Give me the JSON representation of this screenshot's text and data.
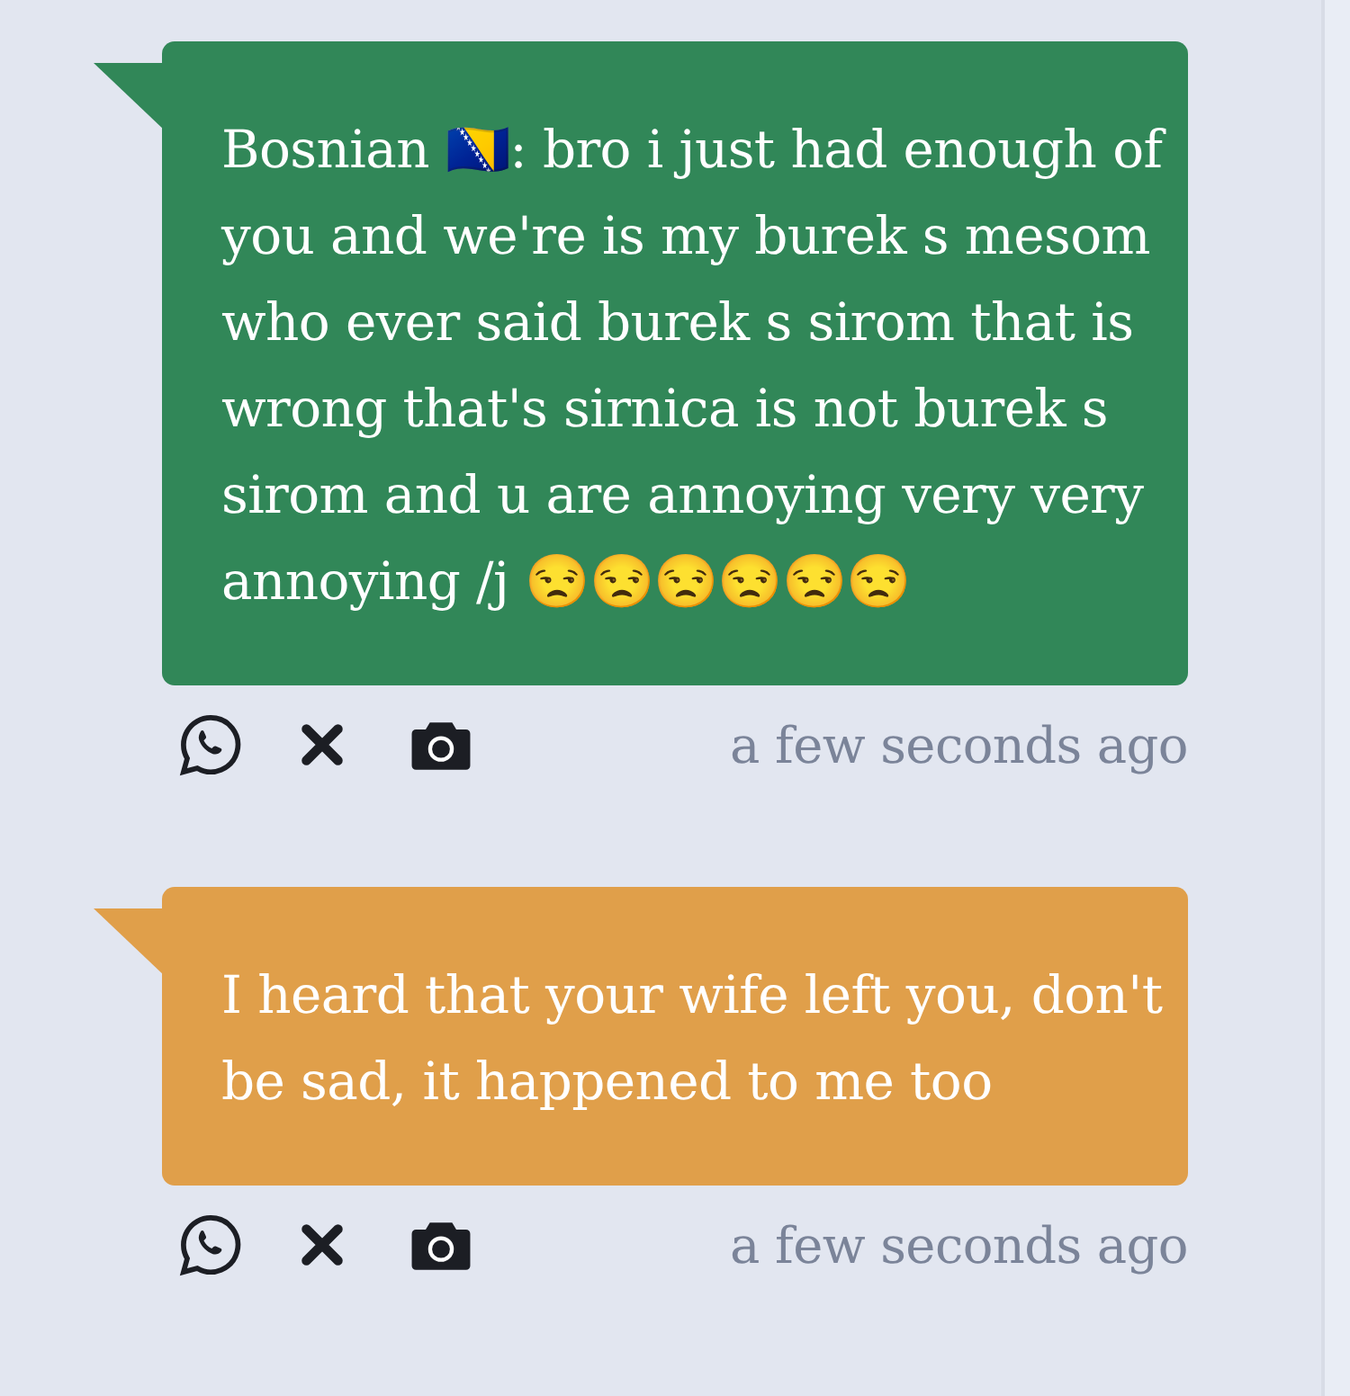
{
  "messages": [
    {
      "text": "Bosnian 🇧🇦: bro i just had enough of you and we're is my burek s mesom who ever said burek s sirom that is wrong that's sirnica is not burek s sirom and u are annoying very very annoying /j 😒😒😒😒😒😒",
      "color": "#318758",
      "time": "a few seconds ago"
    },
    {
      "text": "I heard that your wife left you, don't be sad, it happened to me too",
      "color": "#e09f4a",
      "time": "a few seconds ago"
    }
  ]
}
